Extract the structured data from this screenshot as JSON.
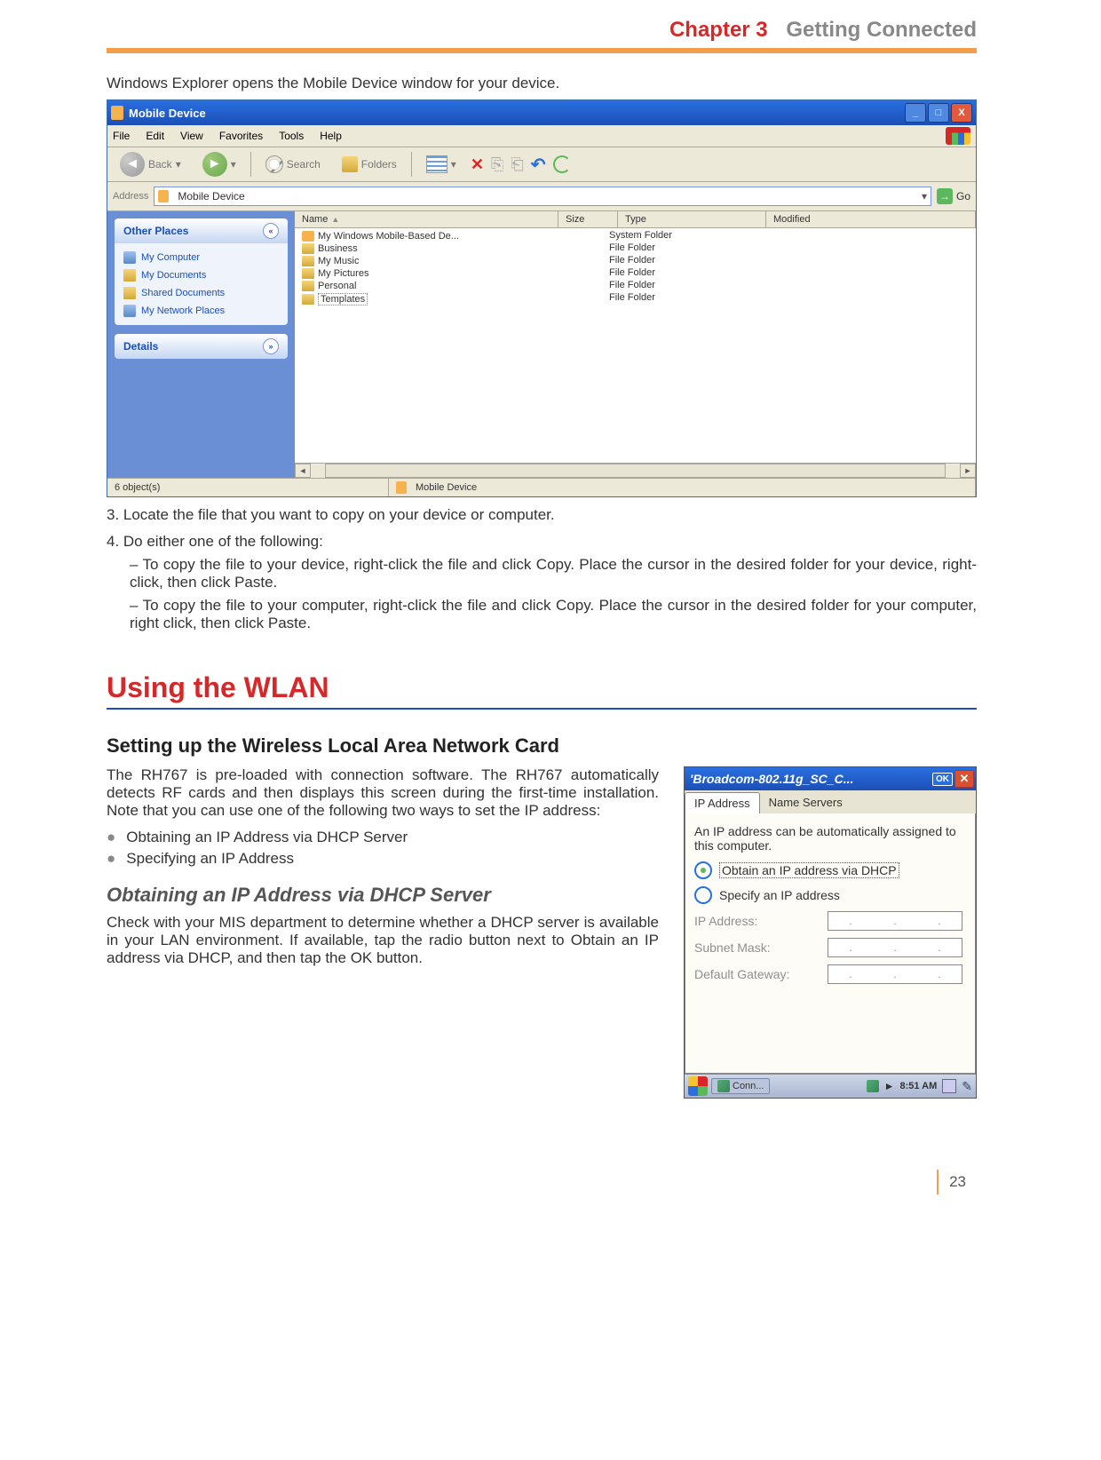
{
  "header": {
    "chapter": "Chapter 3",
    "title": "Getting Connected"
  },
  "intro": "Windows Explorer opens the Mobile Device window for your device.",
  "explorer": {
    "title": "Mobile Device",
    "menus": [
      "File",
      "Edit",
      "View",
      "Favorites",
      "Tools",
      "Help"
    ],
    "toolbar": {
      "back": "Back",
      "search": "Search",
      "folders": "Folders"
    },
    "address": {
      "label": "Address",
      "value": "Mobile Device",
      "go": "Go"
    },
    "sidebar": {
      "other_places": {
        "title": "Other Places",
        "items": [
          "My Computer",
          "My Documents",
          "Shared Documents",
          "My Network Places"
        ]
      },
      "details": {
        "title": "Details"
      }
    },
    "columns": {
      "name": "Name",
      "size": "Size",
      "type": "Type",
      "modified": "Modified"
    },
    "files": [
      {
        "name": "My Windows Mobile-Based De...",
        "type": "System Folder",
        "icon": "dev"
      },
      {
        "name": "Business",
        "type": "File Folder",
        "icon": "folder"
      },
      {
        "name": "My Music",
        "type": "File Folder",
        "icon": "folder"
      },
      {
        "name": "My Pictures",
        "type": "File Folder",
        "icon": "folder"
      },
      {
        "name": "Personal",
        "type": "File Folder",
        "icon": "folder"
      },
      {
        "name": "Templates",
        "type": "File Folder",
        "icon": "folder",
        "selected": true
      }
    ],
    "status": {
      "left": "6 object(s)",
      "right": "Mobile Device"
    }
  },
  "steps": {
    "s3": "3. Locate the file that you want to copy on your device or computer.",
    "s4": "4. Do either one of the following:",
    "s4a": "– To copy the file to your device, right-click the file and click Copy. Place the cursor in the desired folder for your device, right-click, then click Paste.",
    "s4b": "– To copy the file to your computer, right-click the file and click Copy. Place the cursor in the desired folder for your computer, right click, then click Paste."
  },
  "wlan": {
    "h1": "Using the WLAN",
    "h2": "Setting up the Wireless Local Area Network Card",
    "p1": "The RH767 is pre-loaded with connection software. The RH767 automatically detects RF cards and then displays this screen during the first-time installation. Note that you can use one of the following two ways to set the IP address:",
    "b1": "Obtaining an IP Address via DHCP Server",
    "b2": "Specifying an IP Address",
    "h3": "Obtaining an IP Address via DHCP Server",
    "p2": "Check with your MIS department to determine whether a DHCP server is available in your LAN environment. If available, tap the radio button next to Obtain an IP address via DHCP, and then tap the OK button."
  },
  "mdlg": {
    "title": "'Broadcom-802.11g_SC_C...",
    "ok": "OK",
    "tabs": [
      "IP Address",
      "Name Servers"
    ],
    "msg": "An IP address can be automatically assigned to this computer.",
    "opt1": "Obtain an IP address via DHCP",
    "opt2": "Specify an IP address",
    "fields": {
      "ip": "IP Address:",
      "mask": "Subnet Mask:",
      "gw": "Default Gateway:"
    },
    "taskbar": {
      "task": "Conn...",
      "time": "8:51 AM"
    }
  },
  "page_num": "23"
}
